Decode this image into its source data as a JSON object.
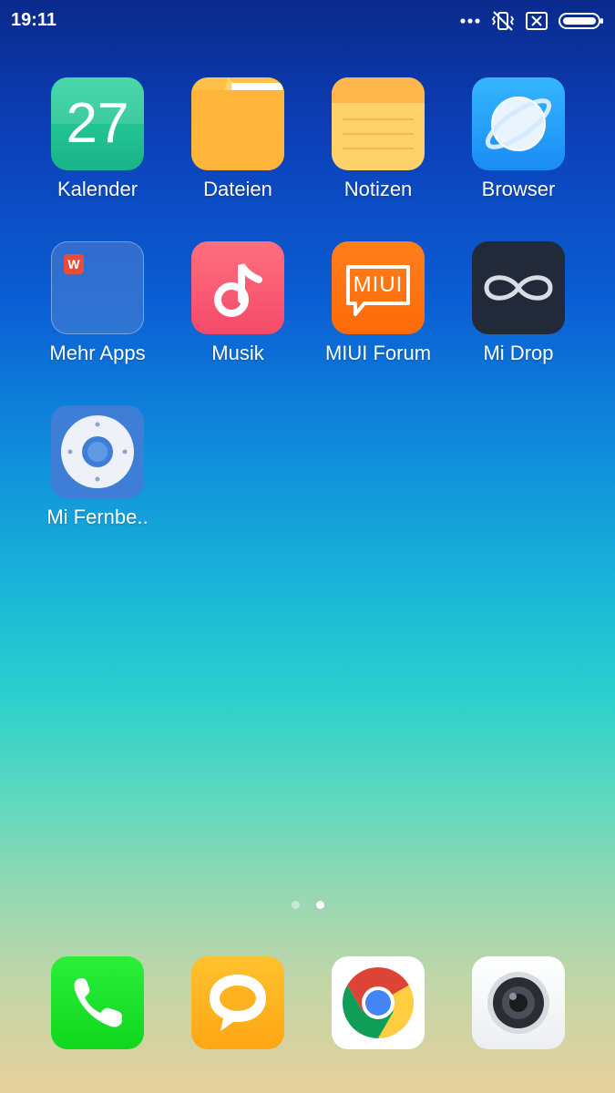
{
  "status_bar": {
    "time": "19:11",
    "icons": [
      "more-dots-icon",
      "vibrate-mute-icon",
      "no-sim-icon",
      "battery-icon"
    ]
  },
  "home_screen": {
    "apps": [
      {
        "label": "Kalender",
        "icon": "calendar-icon",
        "badge": "27"
      },
      {
        "label": "Dateien",
        "icon": "folder-icon"
      },
      {
        "label": "Notizen",
        "icon": "notes-icon"
      },
      {
        "label": "Browser",
        "icon": "browser-icon"
      },
      {
        "label": "Mehr Apps",
        "icon": "app-folder-icon",
        "folder_app_text": "W"
      },
      {
        "label": "Musik",
        "icon": "music-note-icon"
      },
      {
        "label": "MIUI Forum",
        "icon": "miui-forum-icon",
        "logo_text": "MIUI"
      },
      {
        "label": "Mi Drop",
        "icon": "infinity-icon"
      },
      {
        "label": "Mi Fernbe..",
        "icon": "remote-control-icon"
      }
    ],
    "page_indicator": {
      "pages": 2,
      "current": 2
    }
  },
  "dock": {
    "apps": [
      {
        "icon": "phone-icon"
      },
      {
        "icon": "messages-icon"
      },
      {
        "icon": "chrome-icon"
      },
      {
        "icon": "camera-icon"
      }
    ]
  }
}
